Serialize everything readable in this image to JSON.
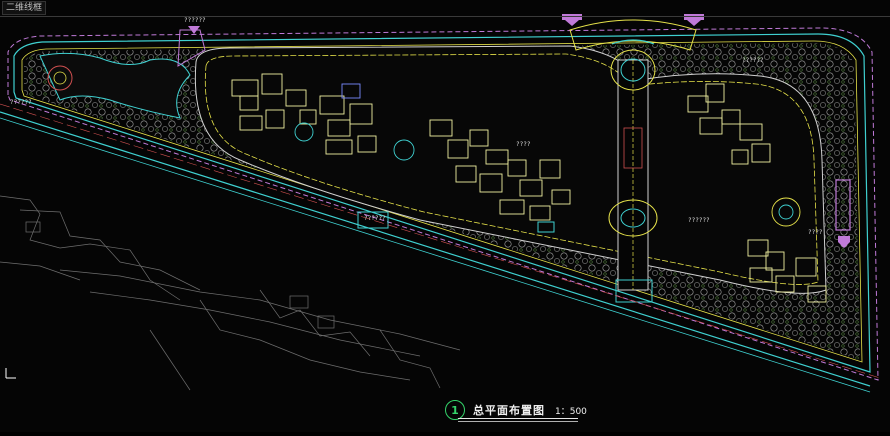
{
  "tab": {
    "label": "二维线框"
  },
  "drawing": {
    "number": "1",
    "title": "总平面布置图",
    "scale": "1：500"
  },
  "colors": {
    "background": "#050505",
    "accent_green": "#34d36a",
    "cyan": "#3fd0d0",
    "magenta": "#c07ad8",
    "yellow": "#e6e24a"
  }
}
